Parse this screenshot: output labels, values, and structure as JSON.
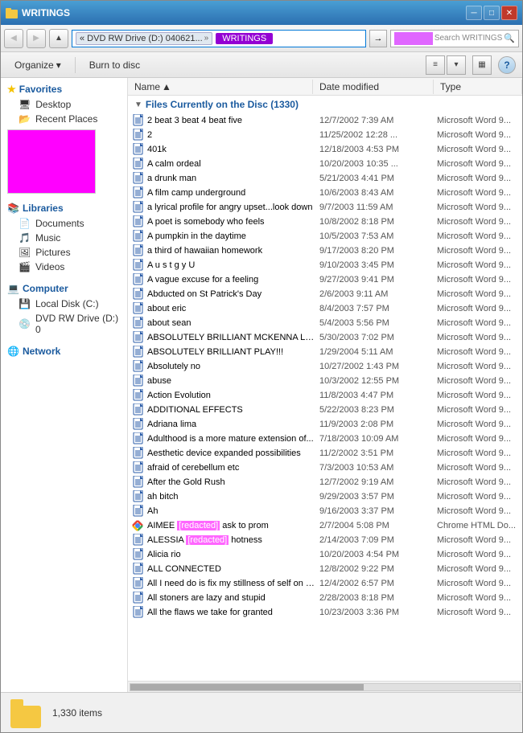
{
  "window": {
    "title": "WRITINGS"
  },
  "titlebar": {
    "text": "WRITINGS",
    "min": "─",
    "max": "□",
    "close": "✕"
  },
  "addressbar": {
    "segment1": "« DVD RW Drive (D:) 040621...",
    "arrow": "»",
    "writings": "WRITINGS",
    "search_placeholder": "Search WRITINGS"
  },
  "toolbar": {
    "organize": "Organize",
    "burn": "Burn to disc",
    "view_change": "▾"
  },
  "sidebar": {
    "favorites_label": "Favorites",
    "desktop_label": "Desktop",
    "recent_label": "Recent Places",
    "libraries_label": "Libraries",
    "documents_label": "Documents",
    "music_label": "Music",
    "pictures_label": "Pictures",
    "videos_label": "Videos",
    "computer_label": "Computer",
    "local_disk_label": "Local Disk (C:)",
    "dvd_label": "DVD RW Drive (D:) 0",
    "network_label": "Network"
  },
  "columns": {
    "name": "Name",
    "date_modified": "Date modified",
    "type": "Type"
  },
  "disc_header": "Files Currently on the Disc (1330)",
  "files": [
    {
      "name": "2 beat 3 beat 4 beat five",
      "date": "12/7/2002 7:39 AM",
      "type": "Microsoft Word 9...",
      "icon": "word"
    },
    {
      "name": "2",
      "date": "11/25/2002 12:28 ...",
      "type": "Microsoft Word 9...",
      "icon": "word"
    },
    {
      "name": "401k",
      "date": "12/18/2003 4:53 PM",
      "type": "Microsoft Word 9...",
      "icon": "word"
    },
    {
      "name": "A calm ordeal",
      "date": "10/20/2003 10:35 ...",
      "type": "Microsoft Word 9...",
      "icon": "word"
    },
    {
      "name": "a drunk man",
      "date": "5/21/2003 4:41 PM",
      "type": "Microsoft Word 9...",
      "icon": "word"
    },
    {
      "name": "A film camp underground",
      "date": "10/6/2003 8:43 AM",
      "type": "Microsoft Word 9...",
      "icon": "word"
    },
    {
      "name": "a lyrical profile for angry upset...look down",
      "date": "9/7/2003 11:59 AM",
      "type": "Microsoft Word 9...",
      "icon": "word"
    },
    {
      "name": "A poet is somebody who feels",
      "date": "10/8/2002 8:18 PM",
      "type": "Microsoft Word 9...",
      "icon": "word"
    },
    {
      "name": "A pumpkin in the daytime",
      "date": "10/5/2003 7:53 AM",
      "type": "Microsoft Word 9...",
      "icon": "word"
    },
    {
      "name": "a third of hawaiian homework",
      "date": "9/17/2003 8:20 PM",
      "type": "Microsoft Word 9...",
      "icon": "word"
    },
    {
      "name": "A u s t g y U",
      "date": "9/10/2003 3:45 PM",
      "type": "Microsoft Word 9...",
      "icon": "word"
    },
    {
      "name": "A vague excuse for a feeling",
      "date": "9/27/2003 9:41 PM",
      "type": "Microsoft Word 9...",
      "icon": "word"
    },
    {
      "name": "Abducted on St Patrick's Day",
      "date": "2/6/2003 9:11 AM",
      "type": "Microsoft Word 9...",
      "icon": "word"
    },
    {
      "name": "about eric",
      "date": "8/4/2003 7:57 PM",
      "type": "Microsoft Word 9...",
      "icon": "word"
    },
    {
      "name": "about sean",
      "date": "5/4/2003 5:56 PM",
      "type": "Microsoft Word 9...",
      "icon": "word"
    },
    {
      "name": "ABSOLUTELY BRILLIANT MCKENNA LEC...",
      "date": "5/30/2003 7:02 PM",
      "type": "Microsoft Word 9...",
      "icon": "word"
    },
    {
      "name": "ABSOLUTELY BRILLIANT PLAY!!!",
      "date": "1/29/2004 5:11 AM",
      "type": "Microsoft Word 9...",
      "icon": "word"
    },
    {
      "name": "Absolutely no",
      "date": "10/27/2002 1:43 PM",
      "type": "Microsoft Word 9...",
      "icon": "word"
    },
    {
      "name": "abuse",
      "date": "10/3/2002 12:55 PM",
      "type": "Microsoft Word 9...",
      "icon": "word"
    },
    {
      "name": "Action Evolution",
      "date": "11/8/2003 4:47 PM",
      "type": "Microsoft Word 9...",
      "icon": "word"
    },
    {
      "name": "ADDITIONAL EFFECTS",
      "date": "5/22/2003 8:23 PM",
      "type": "Microsoft Word 9...",
      "icon": "word"
    },
    {
      "name": "Adriana lima",
      "date": "11/9/2003 2:08 PM",
      "type": "Microsoft Word 9...",
      "icon": "word"
    },
    {
      "name": "Adulthood is a more mature extension of...",
      "date": "7/18/2003 10:09 AM",
      "type": "Microsoft Word 9...",
      "icon": "word"
    },
    {
      "name": "Aesthetic device expanded possibilities",
      "date": "11/2/2002 3:51 PM",
      "type": "Microsoft Word 9...",
      "icon": "word"
    },
    {
      "name": "afraid of cerebellum etc",
      "date": "7/3/2003 10:53 AM",
      "type": "Microsoft Word 9...",
      "icon": "word"
    },
    {
      "name": "After the Gold Rush",
      "date": "12/7/2002 9:19 AM",
      "type": "Microsoft Word 9...",
      "icon": "word"
    },
    {
      "name": "ah bitch",
      "date": "9/29/2003 3:57 PM",
      "type": "Microsoft Word 9...",
      "icon": "word"
    },
    {
      "name": "Ah",
      "date": "9/16/2003 3:37 PM",
      "type": "Microsoft Word 9...",
      "icon": "word"
    },
    {
      "name": "AIMEE [redacted] ask to prom",
      "date": "2/7/2004 5:08 PM",
      "type": "Chrome HTML Do...",
      "icon": "chrome",
      "highlight": true
    },
    {
      "name": "ALESSIA [redacted] hotness",
      "date": "2/14/2003 7:09 PM",
      "type": "Microsoft Word 9...",
      "icon": "word",
      "highlight2": true
    },
    {
      "name": "Alicia rio",
      "date": "10/20/2003 4:54 PM",
      "type": "Microsoft Word 9...",
      "icon": "word"
    },
    {
      "name": "ALL CONNECTED",
      "date": "12/8/2002 9:22 PM",
      "type": "Microsoft Word 9...",
      "icon": "word"
    },
    {
      "name": "All I need do is fix my stillness of self on s...",
      "date": "12/4/2002 6:57 PM",
      "type": "Microsoft Word 9...",
      "icon": "word"
    },
    {
      "name": "All stoners are lazy and stupid",
      "date": "2/28/2003 8:18 PM",
      "type": "Microsoft Word 9...",
      "icon": "word"
    },
    {
      "name": "All the flaws we take for granted",
      "date": "10/23/2003 3:36 PM",
      "type": "Microsoft Word 9...",
      "icon": "word"
    }
  ],
  "status": {
    "count": "1,330 items"
  }
}
